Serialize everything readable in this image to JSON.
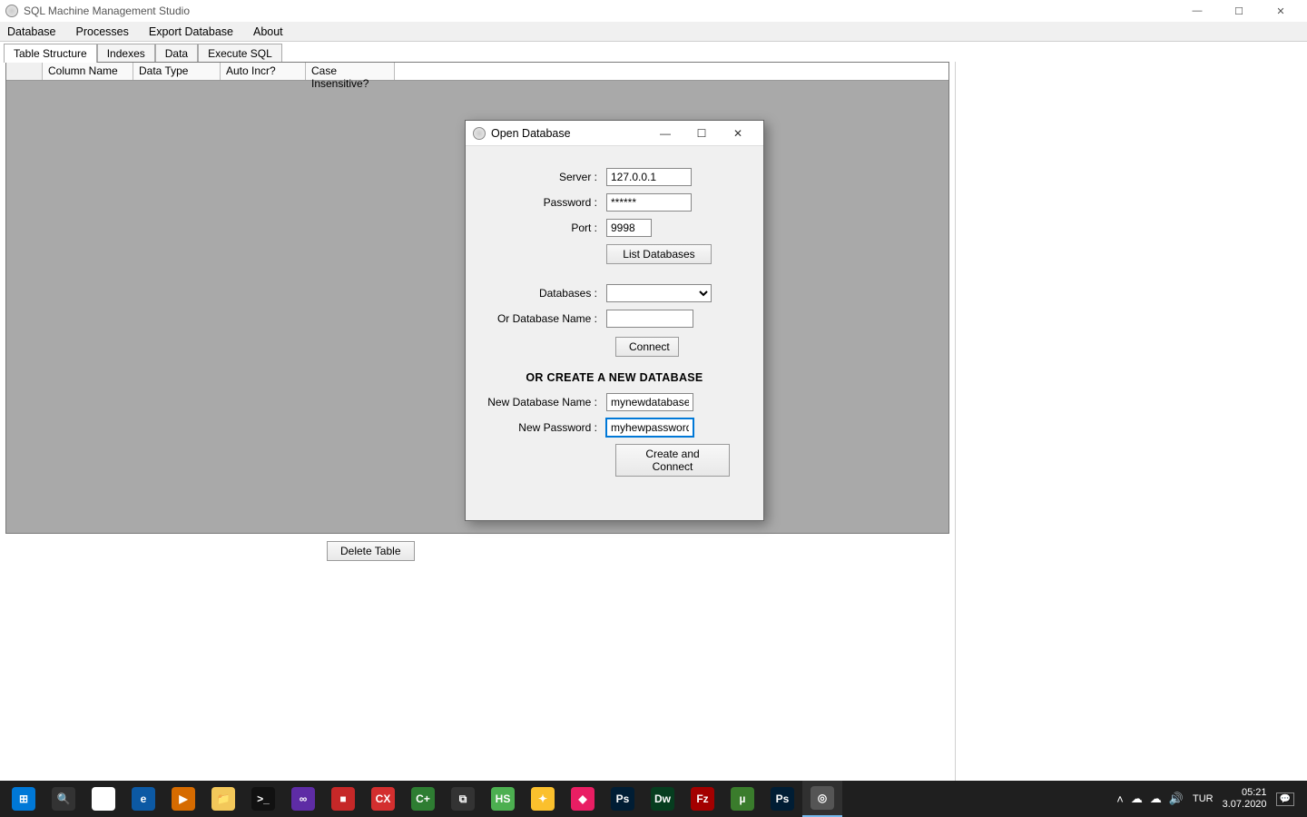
{
  "window": {
    "title": "SQL Machine Management Studio",
    "controls": {
      "min": "—",
      "max": "☐",
      "close": "✕"
    }
  },
  "menu": {
    "items": [
      "Database",
      "Processes",
      "Export Database",
      "About"
    ]
  },
  "tabs": {
    "items": [
      "Table Structure",
      "Indexes",
      "Data",
      "Execute SQL"
    ],
    "active_index": 0
  },
  "grid": {
    "headers": [
      "",
      "Column Name",
      "Data Type",
      "Auto Incr?",
      "Case Insensitive?"
    ]
  },
  "buttons": {
    "delete_table": "Delete Table",
    "list_databases": "List Databases",
    "connect": "Connect",
    "create_connect": "Create and Connect"
  },
  "dialog": {
    "title": "Open Database",
    "controls": {
      "min": "—",
      "max": "☐",
      "close": "✕"
    },
    "labels": {
      "server": "Server :",
      "password": "Password :",
      "port": "Port :",
      "databases": "Databases :",
      "or_dbname": "Or Database Name :",
      "section": "OR CREATE A NEW DATABASE",
      "new_dbname": "New Database Name :",
      "new_password": "New Password :"
    },
    "values": {
      "server": "127.0.0.1",
      "password": "******",
      "port": "9998",
      "databases_selected": "",
      "or_dbname": "",
      "new_dbname": "mynewdatabase",
      "new_password": "myhewpassword"
    }
  },
  "taskbar": {
    "apps": [
      {
        "name": "start",
        "bg": "#0078d7",
        "label": "⊞"
      },
      {
        "name": "search",
        "bg": "#333",
        "label": "🔍"
      },
      {
        "name": "chrome",
        "bg": "#fff",
        "label": "◉"
      },
      {
        "name": "edge",
        "bg": "#0c59a4",
        "label": "e"
      },
      {
        "name": "media",
        "bg": "#d66b00",
        "label": "▶"
      },
      {
        "name": "explorer",
        "bg": "#f3c85a",
        "label": "📁"
      },
      {
        "name": "cmd",
        "bg": "#111",
        "label": ">_"
      },
      {
        "name": "vs",
        "bg": "#5e2ca5",
        "label": "∞"
      },
      {
        "name": "app-red1",
        "bg": "#c62828",
        "label": "■"
      },
      {
        "name": "app-cx",
        "bg": "#d32f2f",
        "label": "CX"
      },
      {
        "name": "app-cpp",
        "bg": "#2e7d32",
        "label": "C+"
      },
      {
        "name": "app-win",
        "bg": "#333",
        "label": "⧉"
      },
      {
        "name": "app-hs",
        "bg": "#4caf50",
        "label": "HS"
      },
      {
        "name": "app-y",
        "bg": "#fbc02d",
        "label": "✦"
      },
      {
        "name": "app-pink",
        "bg": "#e91e63",
        "label": "◆"
      },
      {
        "name": "ps",
        "bg": "#001d34",
        "label": "Ps"
      },
      {
        "name": "dw",
        "bg": "#063d1f",
        "label": "Dw"
      },
      {
        "name": "fz",
        "bg": "#a30000",
        "label": "Fz"
      },
      {
        "name": "utorrent",
        "bg": "#3a7c2c",
        "label": "µ"
      },
      {
        "name": "ps2",
        "bg": "#001d34",
        "label": "Ps"
      },
      {
        "name": "app-current",
        "bg": "#555",
        "label": "◎",
        "active": true
      }
    ],
    "tray": {
      "up": "˄",
      "cloud": "☁",
      "cloud2": "☁",
      "vol": "🔊"
    },
    "lang": "TUR",
    "time": "05:21",
    "date": "3.07.2020"
  }
}
